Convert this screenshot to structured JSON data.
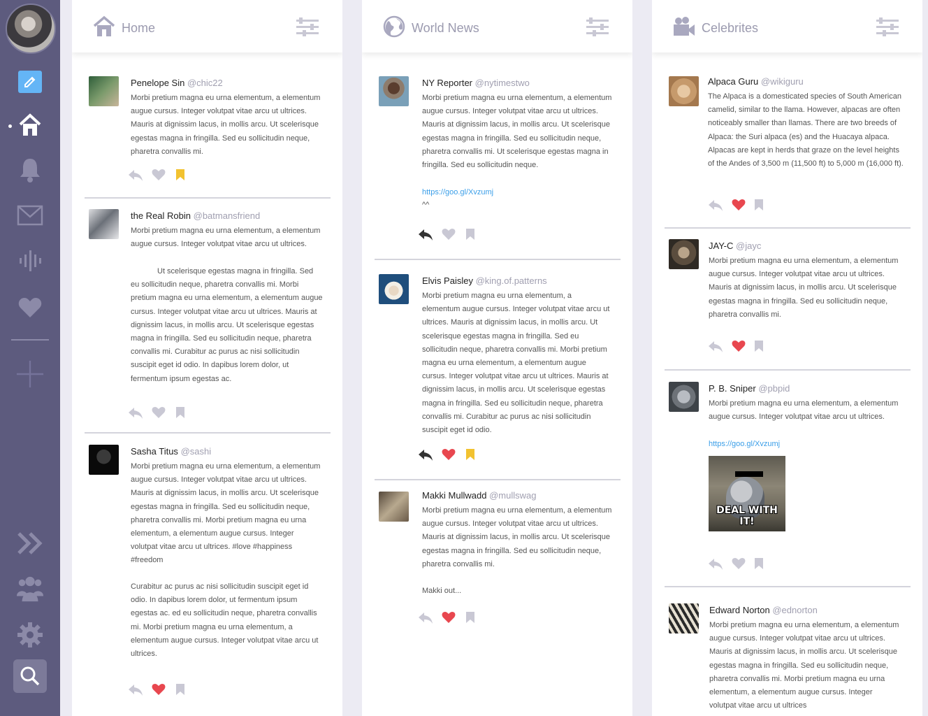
{
  "colors": {
    "sidebar": "#5d5b7e",
    "accent_blue": "#64b5f6",
    "heart_red": "#e8474f",
    "bookmark_yellow": "#f2c230",
    "icon_gray": "#c9c8d4",
    "link": "#3a9ee8"
  },
  "sidebar": {
    "items": [
      {
        "icon": "pencil-icon"
      },
      {
        "icon": "home-icon"
      },
      {
        "icon": "bell-icon"
      },
      {
        "icon": "mail-icon"
      },
      {
        "icon": "audio-icon"
      },
      {
        "icon": "heart-icon"
      },
      {
        "icon": "plus-icon"
      },
      {
        "icon": "double-chevron-icon"
      },
      {
        "icon": "group-icon"
      },
      {
        "icon": "gear-icon"
      },
      {
        "icon": "search-icon"
      }
    ]
  },
  "columns": [
    {
      "title": "Home",
      "posts": [
        {
          "name": "Penelope Sin",
          "handle": "@chic22",
          "text": "Morbi pretium magna eu urna elementum, a elementum augue cursus. Integer volutpat vitae arcu ut ultrices. Mauris at dignissim lacus, in mollis arcu. Ut scelerisque egestas magna in fringilla. Sed eu sollicitudin neque, pharetra convallis mi.",
          "liked": false,
          "bookmarked": true
        },
        {
          "name": "the Real Robin",
          "handle": "@batmansfriend",
          "text": "Morbi pretium magna eu urna elementum, a elementum augue cursus. Integer volutpat vitae arcu ut ultrices.",
          "text2": "Ut scelerisque egestas magna in fringilla. Sed eu sollicitudin neque, pharetra convallis mi. Morbi pretium magna eu urna elementum, a elementum augue cursus. Integer volutpat vitae arcu ut ultrices. Mauris at dignissim lacus, in mollis arcu. Ut scelerisque egestas magna in fringilla. Sed eu sollicitudin neque, pharetra convallis mi. Curabitur ac purus ac nisi sollicitudin suscipit eget id odio. In dapibus lorem dolor, ut fermentum ipsum egestas ac.",
          "liked": false,
          "bookmarked": false
        },
        {
          "name": "Sasha Titus",
          "handle": "@sashi",
          "text": "Morbi pretium magna eu urna elementum, a elementum augue cursus. Integer volutpat vitae arcu ut ultrices. Mauris at dignissim lacus, in mollis arcu. Ut scelerisque egestas magna in fringilla. Sed eu sollicitudin neque, pharetra convallis mi. Morbi pretium magna eu urna elementum, a elementum augue cursus. Integer volutpat vitae arcu ut ultrices. #love #happiness #freedom",
          "text2": "Curabitur ac purus ac nisi sollicitudin suscipit eget id odio. In dapibus lorem dolor, ut fermentum ipsum egestas ac. ed eu sollicitudin neque, pharetra convallis mi. Morbi pretium magna eu urna elementum, a elementum augue cursus. Integer volutpat vitae arcu ut ultrices.",
          "liked": true,
          "bookmarked": false
        }
      ]
    },
    {
      "title": "World News",
      "posts": [
        {
          "name": "NY Reporter",
          "handle": "@nytimestwo",
          "text": "Morbi pretium magna eu urna elementum, a elementum augue cursus. Integer volutpat vitae arcu ut ultrices. Mauris at dignissim lacus, in mollis arcu. Ut scelerisque egestas magna in fringilla. Sed eu sollicitudin neque, pharetra convallis mi.  Ut scelerisque egestas magna in fringilla. Sed eu sollicitudin neque.",
          "link": "https://goo.gl/Xvzumj",
          "extra": "^^",
          "liked": false,
          "bookmarked": false,
          "replied": true
        },
        {
          "name": "Elvis Paisley",
          "handle": "@king.of.patterns",
          "text": "Morbi pretium magna eu urna elementum, a elementum augue cursus. Integer volutpat vitae arcu ut ultrices. Mauris at dignissim lacus, in mollis arcu. Ut scelerisque egestas magna in fringilla. Sed eu sollicitudin neque, pharetra convallis mi. Morbi pretium magna eu urna elementum, a elementum augue cursus. Integer volutpat vitae arcu ut ultrices. Mauris at dignissim lacus, in mollis arcu. Ut scelerisque egestas magna in fringilla. Sed eu sollicitudin neque, pharetra convallis mi. Curabitur ac purus ac nisi sollicitudin suscipit eget id odio.",
          "liked": true,
          "bookmarked": true,
          "replied": true
        },
        {
          "name": "Makki Mullwadd",
          "handle": "@mullswag",
          "text": "Morbi pretium magna eu urna elementum, a elementum augue cursus. Integer volutpat vitae arcu ut ultrices. Mauris at dignissim lacus, in mollis arcu. Ut scelerisque egestas magna in fringilla. Sed eu sollicitudin neque, pharetra convallis mi.",
          "extra": "Makki out...",
          "liked": true,
          "bookmarked": false
        }
      ]
    },
    {
      "title": "Celebrites",
      "posts": [
        {
          "name": "Alpaca Guru",
          "handle": "@wikiguru",
          "text": "The Alpaca is a domesticated species of South American camelid, similar to the llama. However, alpacas are often noticeably smaller than llamas. There are two breeds of Alpaca: the Suri alpaca (es) and the Huacaya alpaca. Alpacas are kept in herds that graze on the level heights of the Andes of 3,500 m (11,500 ft) to 5,000 m (16,000 ft).",
          "liked": true,
          "bookmarked": false
        },
        {
          "name": "JAY-C",
          "handle": "@jayc",
          "text": "Morbi pretium magna eu urna elementum, a elementum augue cursus. Integer volutpat vitae arcu ut ultrices. Mauris at dignissim lacus, in mollis arcu. Ut scelerisque egestas magna in fringilla. Sed eu sollicitudin neque, pharetra convallis mi.",
          "liked": true,
          "bookmarked": false
        },
        {
          "name": "P. B. Sniper",
          "handle": "@pbpid",
          "text": "Morbi pretium magna eu urna elementum, a elementum augue cursus. Integer volutpat vitae arcu ut ultrices.",
          "link": "https://goo.gl/Xvzumj",
          "meme_caption": "DEAL WITH IT!",
          "liked": false,
          "bookmarked": false
        },
        {
          "name": "Edward Norton",
          "handle": "@ednorton",
          "text": "Morbi pretium magna eu urna elementum, a elementum augue cursus. Integer volutpat vitae arcu ut ultrices. Mauris at dignissim lacus, in mollis arcu. Ut scelerisque egestas magna in fringilla. Sed eu sollicitudin neque, pharetra convallis mi. Morbi pretium magna eu urna elementum, a elementum augue cursus. Integer volutpat vitae arcu ut ultrices"
        }
      ]
    }
  ]
}
